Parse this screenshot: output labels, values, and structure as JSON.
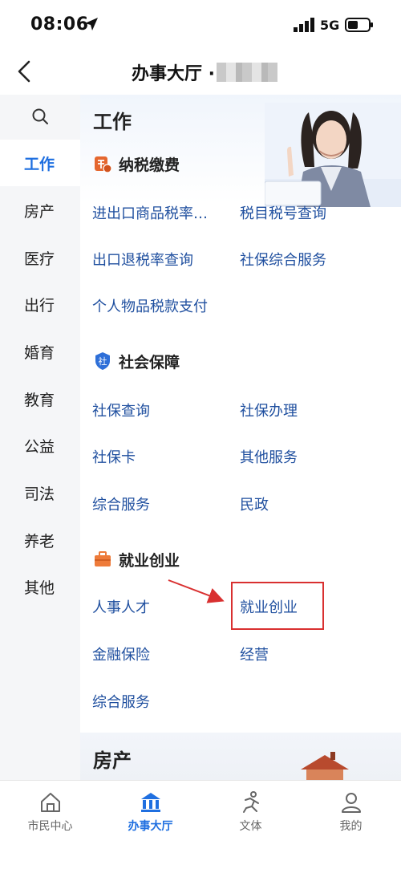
{
  "status_bar": {
    "time": "08:06",
    "network": "5G"
  },
  "nav": {
    "title": "办事大厅 ·"
  },
  "sidebar": {
    "items": [
      {
        "label": "工作",
        "active": true
      },
      {
        "label": "房产"
      },
      {
        "label": "医疗"
      },
      {
        "label": "出行"
      },
      {
        "label": "婚育"
      },
      {
        "label": "教育"
      },
      {
        "label": "公益"
      },
      {
        "label": "司法"
      },
      {
        "label": "养老"
      },
      {
        "label": "其他"
      }
    ]
  },
  "main": {
    "section_title": "工作",
    "groups": [
      {
        "title": "纳税缴费",
        "items": [
          "进出口商品税率…",
          "税目税号查询",
          "出口退税率查询",
          "社保综合服务",
          "个人物品税款支付"
        ]
      },
      {
        "title": "社会保障",
        "items": [
          "社保查询",
          "社保办理",
          "社保卡",
          "其他服务",
          "综合服务",
          "民政"
        ]
      },
      {
        "title": "就业创业",
        "items": [
          "人事人才",
          "就业创业",
          "金融保险",
          "经营",
          "综合服务"
        ]
      }
    ],
    "next_section_title": "房产"
  },
  "tab_bar": {
    "tabs": [
      {
        "label": "市民中心",
        "icon": "home-icon"
      },
      {
        "label": "办事大厅",
        "icon": "bank-icon",
        "active": true
      },
      {
        "label": "文体",
        "icon": "running-person-icon"
      },
      {
        "label": "我的",
        "icon": "user-icon"
      }
    ]
  },
  "colors": {
    "accent": "#1f6fe0",
    "link": "#1f4f9f",
    "annotation": "#d93030"
  }
}
